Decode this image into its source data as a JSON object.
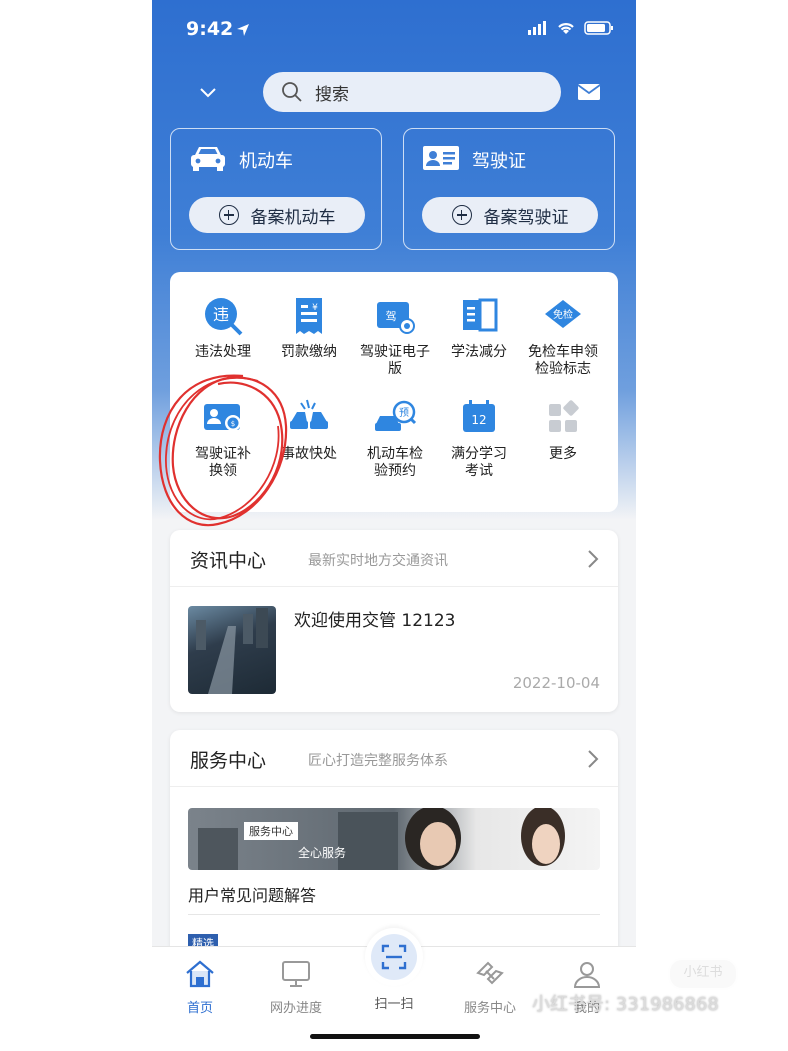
{
  "status": {
    "time": "9:42"
  },
  "search": {
    "placeholder": "搜索"
  },
  "cards": [
    {
      "title": "机动车",
      "button": "备案机动车"
    },
    {
      "title": "驾驶证",
      "button": "备案驾驶证"
    }
  ],
  "services": [
    {
      "label": "违法处理",
      "icon": "violation-icon"
    },
    {
      "label": "罚款缴纳",
      "icon": "fine-payment-icon"
    },
    {
      "label": "驾驶证电子版",
      "icon": "e-license-icon"
    },
    {
      "label": "学法减分",
      "icon": "study-book-icon"
    },
    {
      "label": "免检车申领检验标志",
      "icon": "exempt-inspection-icon"
    },
    {
      "label": "驾驶证补换领",
      "icon": "license-replace-icon"
    },
    {
      "label": "事故快处",
      "icon": "accident-icon"
    },
    {
      "label": "机动车检验预约",
      "icon": "inspection-booking-icon"
    },
    {
      "label": "满分学习考试",
      "icon": "full-score-study-icon"
    },
    {
      "label": "更多",
      "icon": "more-grid-icon"
    }
  ],
  "service_icon_texts": {
    "violation": "违",
    "license_badge": "驾",
    "exempt": "免检",
    "booking": "预",
    "score": "12"
  },
  "news": {
    "title": "资讯中心",
    "subtitle": "最新实时地方交通资讯",
    "item_title": "欢迎使用交管 12123",
    "item_date": "2022-10-04"
  },
  "service_center": {
    "title": "服务中心",
    "subtitle": "匠心打造完整服务体系",
    "banner_tag": "服务中心",
    "banner_text": "全心服务",
    "faq": "用户常见问题解答",
    "chip": "精选"
  },
  "tabs": [
    {
      "label": "首页",
      "icon": "home-icon",
      "active": true
    },
    {
      "label": "网办进度",
      "icon": "monitor-icon",
      "active": false
    },
    {
      "label": "扫一扫",
      "icon": "scan-icon",
      "active": false
    },
    {
      "label": "服务中心",
      "icon": "handshake-icon",
      "active": false
    },
    {
      "label": "我的",
      "icon": "user-icon",
      "active": false
    }
  ],
  "watermark": {
    "logo": "小红书",
    "id": "小红书号: 331986868"
  },
  "colors": {
    "primary": "#2e6fd0",
    "annotation": "#e0312f"
  }
}
